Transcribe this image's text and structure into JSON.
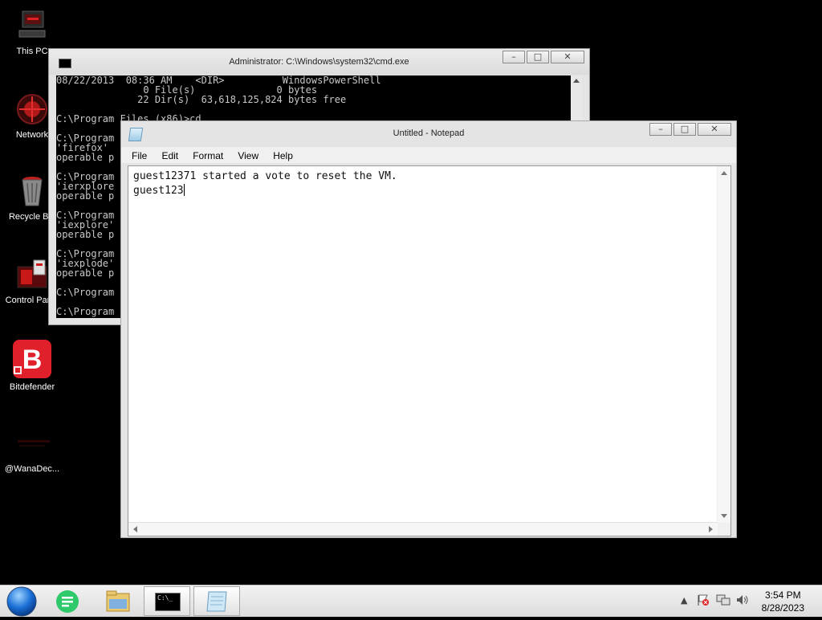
{
  "desktop": {
    "icons": [
      {
        "label": "This PC"
      },
      {
        "label": "Network"
      },
      {
        "label": "Recycle Bin"
      },
      {
        "label": "Control Panel"
      },
      {
        "label": "Bitdefender"
      },
      {
        "label": "@WanaDec..."
      }
    ]
  },
  "cmd": {
    "title": "Administrator: C:\\Windows\\system32\\cmd.exe",
    "lines": [
      "08/22/2013  08:36 AM    <DIR>          WindowsPowerShell",
      "               0 File(s)              0 bytes",
      "              22 Dir(s)  63,618,125,824 bytes free",
      "",
      "C:\\Program Files (x86)>cd",
      "",
      "C:\\Program",
      "'firefox'",
      "operable p",
      "",
      "C:\\Program",
      "'ierxplore",
      "operable p",
      "",
      "C:\\Program",
      "'iexplore'",
      "operable p",
      "",
      "C:\\Program",
      "'iexplode'",
      "operable p",
      "",
      "C:\\Program",
      "",
      "C:\\Program"
    ]
  },
  "notepad": {
    "title": "Untitled - Notepad",
    "menu": [
      "File",
      "Edit",
      "Format",
      "View",
      "Help"
    ],
    "lines": [
      "guest12371 started a vote to reset the VM.",
      "guest123"
    ]
  },
  "taskbar": {
    "time": "3:54 PM",
    "date": "8/28/2023",
    "cmd_icon_text": "C:\\_"
  },
  "colors": {
    "desktop_bg": "#000000",
    "bitdefender_red": "#e0202a",
    "start_orb": "#1a6fd6"
  }
}
